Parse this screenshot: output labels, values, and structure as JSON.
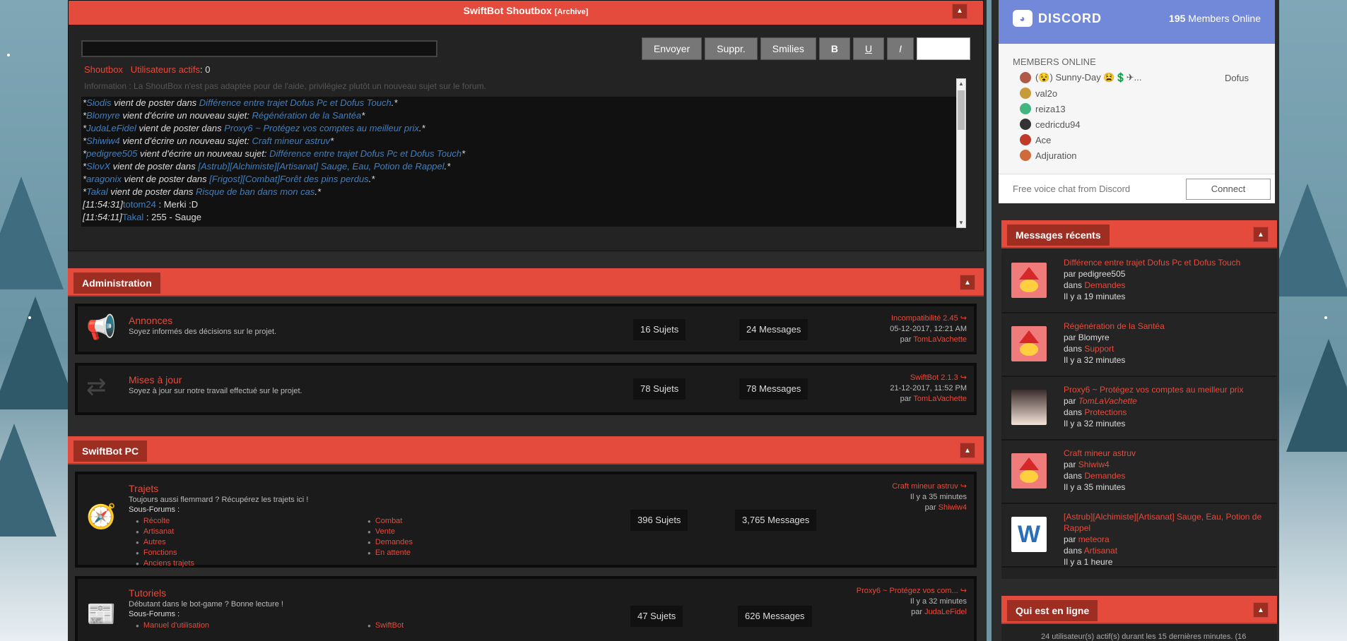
{
  "shoutbox": {
    "title": "SwiftBot Shoutbox",
    "archive": "[Archive]",
    "buttons": {
      "send": "Envoyer",
      "delete": "Suppr.",
      "smilies": "Smilies",
      "bold": "B",
      "underline": "U",
      "italic": "I"
    },
    "label": "Shoutbox",
    "active_users_label": "Utilisateurs actifs",
    "active_users_count": ": 0",
    "info": "Information : La ShoutBox n'est pas adaptée pour de l'aide, privilégiez plutôt un nouveau sujet sur le forum.",
    "lines": [
      {
        "pre": "*",
        "user": "Siodis",
        "mid": " vient de poster dans ",
        "topic": "Différence entre trajet Dofus Pc et Dofus Touch",
        "post": ".*"
      },
      {
        "pre": "*",
        "user": "Blomyre",
        "mid": " vient d'écrire un nouveau sujet: ",
        "topic": "Régénération de la Santéa",
        "post": "*"
      },
      {
        "pre": "*",
        "user": "JudaLeFidel",
        "mid": " vient de poster dans ",
        "topic": "Proxy6 ~ Protégez vos comptes au meilleur prix",
        "post": ".*"
      },
      {
        "pre": "*",
        "user": "Shiwiw4",
        "mid": " vient d'écrire un nouveau sujet: ",
        "topic": "Craft mineur astruv",
        "post": "*"
      },
      {
        "pre": "*",
        "user": "pedigree505",
        "mid": " vient d'écrire un nouveau sujet: ",
        "topic": "Différence entre trajet Dofus Pc et Dofus Touch",
        "post": "*"
      },
      {
        "pre": "*",
        "user": "SlovX",
        "mid": " vient de poster dans ",
        "topic": "[Astrub][Alchimiste][Artisanat] Sauge, Eau, Potion de Rappel",
        "post": ".*"
      },
      {
        "pre": "*",
        "user": "aragonix",
        "mid": " vient de poster dans ",
        "topic": "[Frigost][Combat]Forêt des pins perdus",
        "post": ".*"
      },
      {
        "pre": "*",
        "user": "Takal",
        "mid": " vient de poster dans ",
        "topic": "Risque de ban dans mon cas",
        "post": ".*"
      }
    ],
    "chat": [
      {
        "time": "[11:54:31]",
        "user": "totom24",
        "msg": " : Merki :D"
      },
      {
        "time": "[11:54:11]",
        "user": "Takal",
        "msg": " : 255 - Sauge"
      }
    ]
  },
  "categories": [
    {
      "title": "Administration",
      "forums": [
        {
          "name": "Annonces",
          "desc": "Soyez informés des décisions sur le projet.",
          "icon": "megaphone-icon",
          "topics": "16 Sujets",
          "messages": "24 Messages",
          "last_title": "Incompatibilité 2.45",
          "last_date": "05-12-2017, 12:21 AM",
          "last_by_prefix": "par ",
          "last_by": "TomLaVachette"
        },
        {
          "name": "Mises à jour",
          "desc": "Soyez à jour sur notre travail effectué sur le projet.",
          "icon": "refresh-icon",
          "topics": "78 Sujets",
          "messages": "78 Messages",
          "last_title": "SwiftBot 2.1.3",
          "last_date": "21-12-2017, 11:52 PM",
          "last_by_prefix": "par ",
          "last_by": "TomLaVachette"
        }
      ]
    },
    {
      "title": "SwiftBot PC",
      "forums": [
        {
          "name": "Trajets",
          "desc": "Toujours aussi flemmard ? Récupérez les trajets ici !",
          "icon": "compass-icon",
          "sub_label": "Sous-Forums :",
          "subs_left": [
            "Récolte",
            "Artisanat",
            "Autres",
            "Fonctions",
            "Anciens trajets"
          ],
          "subs_right": [
            "Combat",
            "Vente",
            "Demandes",
            "En attente"
          ],
          "topics": "396 Sujets",
          "messages": "3,765 Messages",
          "last_title": "Craft mineur astruv",
          "last_date": "Il y a 35 minutes",
          "last_by_prefix": "par ",
          "last_by": "Shiwiw4"
        },
        {
          "name": "Tutoriels",
          "desc": "Débutant dans le bot-game ? Bonne lecture !",
          "icon": "newspaper-icon",
          "sub_label": "Sous-Forums :",
          "subs_left": [
            "Manuel d'utilisation"
          ],
          "subs_right": [
            "SwiftBot"
          ],
          "topics": "47 Sujets",
          "messages": "626 Messages",
          "last_title": "Proxy6 ~ Protégez vos com...",
          "last_date": "Il y a 32 minutes",
          "last_by_prefix": "par ",
          "last_by": "JudaLeFidel"
        }
      ]
    }
  ],
  "discord": {
    "brand": "DISCORD",
    "online_count": "195",
    "online_label": " Members Online",
    "members_header": "MEMBERS ONLINE",
    "members": [
      {
        "name": "(😵) Sunny-Day 😫💲✈...",
        "game": "Dofus",
        "color": "#b05a4a"
      },
      {
        "name": "val2o",
        "game": "",
        "color": "#c79a3a"
      },
      {
        "name": "reiza13",
        "game": "",
        "color": "#43b581"
      },
      {
        "name": "cedricdu94",
        "game": "",
        "color": "#333333"
      },
      {
        "name": "Ace",
        "game": "",
        "color": "#c0392b"
      },
      {
        "name": "Adjuration",
        "game": "",
        "color": "#d06a3a"
      }
    ],
    "footer": "Free voice chat from Discord",
    "connect": "Connect"
  },
  "recent": {
    "title": "Messages récents",
    "items": [
      {
        "title": "Différence entre trajet Dofus Pc et Dofus Touch",
        "by_prefix": "par ",
        "by": "pedigree505",
        "in_prefix": "dans ",
        "in": "Demandes",
        "when": "Il y a 19 minutes",
        "thumb": "santa-chick"
      },
      {
        "title": "Régénération de la Santéa",
        "by_prefix": "par ",
        "by": "Blomyre",
        "in_prefix": "dans ",
        "in": "Support",
        "when": "Il y a 32 minutes",
        "thumb": "santa-chick"
      },
      {
        "title": "Proxy6 ~ Protégez vos comptes au meilleur prix",
        "by_prefix": "par ",
        "by": "TomLaVachette",
        "in_prefix": "dans ",
        "in": "Protections",
        "when": "Il y a 32 minutes",
        "thumb": "anime-avatar"
      },
      {
        "title": "Craft mineur astruv",
        "by_prefix": "par ",
        "by": "Shiwiw4",
        "in_prefix": "dans ",
        "in": "Demandes",
        "when": "Il y a 35 minutes",
        "thumb": "santa-chick"
      },
      {
        "title": "[Astrub][Alchimiste][Artisanat] Sauge, Eau, Potion de Rappel",
        "by_prefix": "par ",
        "by": "meteora",
        "in_prefix": "dans ",
        "in": "Artisanat",
        "when": "Il y a 1 heure",
        "thumb": "w-logo"
      }
    ]
  },
  "online": {
    "title": "Qui est en ligne",
    "text": "24 utilisateur(s) actif(s) durant les 15 dernières minutes. (16"
  },
  "colors": {
    "accent": "#e54b3c",
    "accent_dark": "#9e2d22",
    "link_blue": "#3d7fc4",
    "panel": "#232323",
    "discord": "#7289da"
  }
}
